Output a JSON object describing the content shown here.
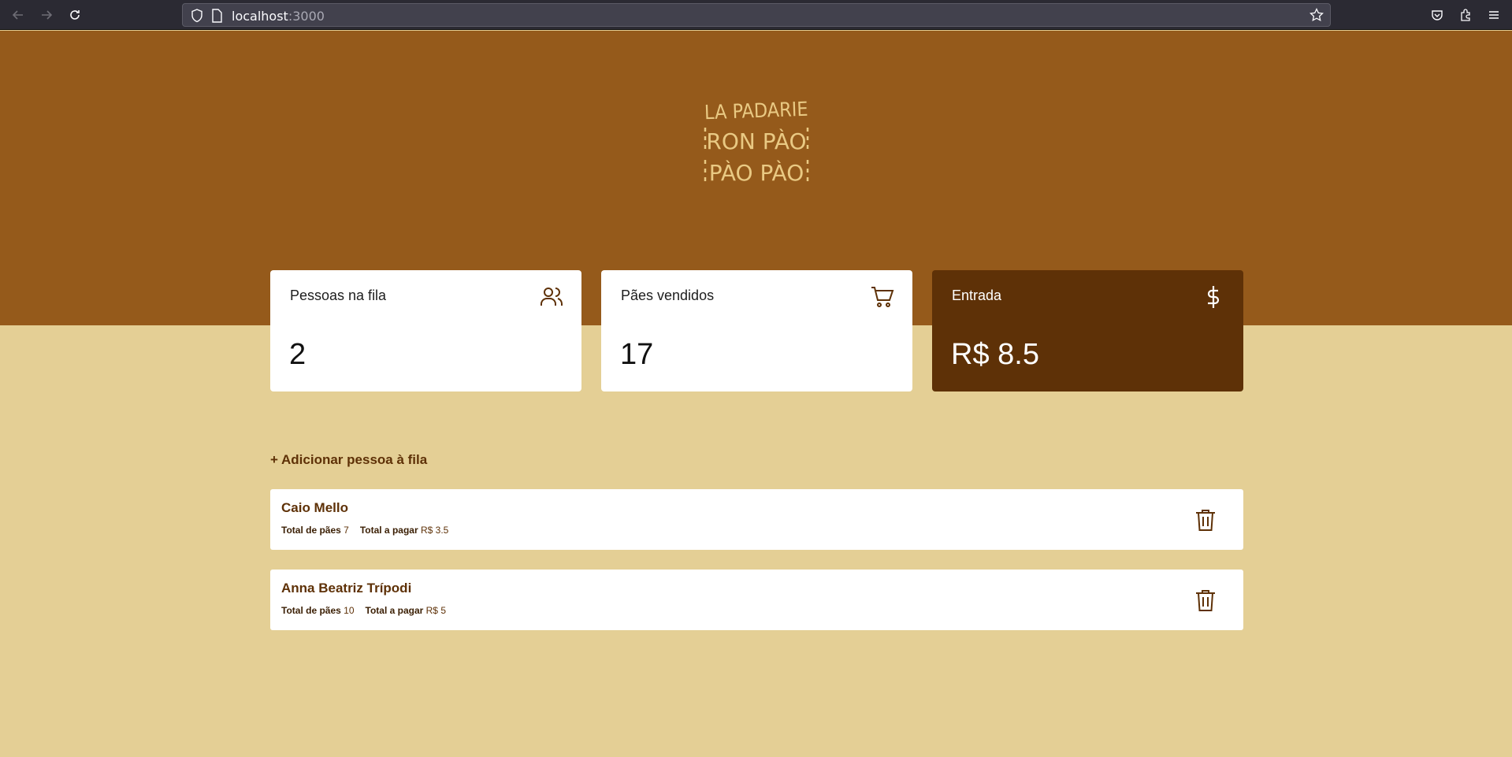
{
  "browser": {
    "url_host": "localhost",
    "url_port": ":3000"
  },
  "brand": {
    "logo_line1": "LA PADARIE",
    "logo_line2": "RON PÀO",
    "logo_line3": "PÀO PÀO",
    "logo_color": "#e9c983"
  },
  "colors": {
    "header": "#955a1b",
    "background": "#e4cf95",
    "accent_dark": "#5e3107"
  },
  "summary": {
    "queue": {
      "title": "Pessoas na fila",
      "value": "2",
      "icon": "users-icon"
    },
    "breads": {
      "title": "Pães vendidos",
      "value": "17",
      "icon": "cart-icon"
    },
    "income": {
      "title": "Entrada",
      "value": "R$ 8.5",
      "icon": "dollar-icon"
    }
  },
  "queue": {
    "add_label": "+ Adicionar pessoa à fila",
    "bread_label": "Total de pães",
    "pay_label": "Total a pagar",
    "items": [
      {
        "name": "Caio Mello",
        "breads": "7",
        "total": "R$ 3.5"
      },
      {
        "name": "Anna Beatriz Trípodi",
        "breads": "10",
        "total": "R$ 5"
      }
    ]
  }
}
